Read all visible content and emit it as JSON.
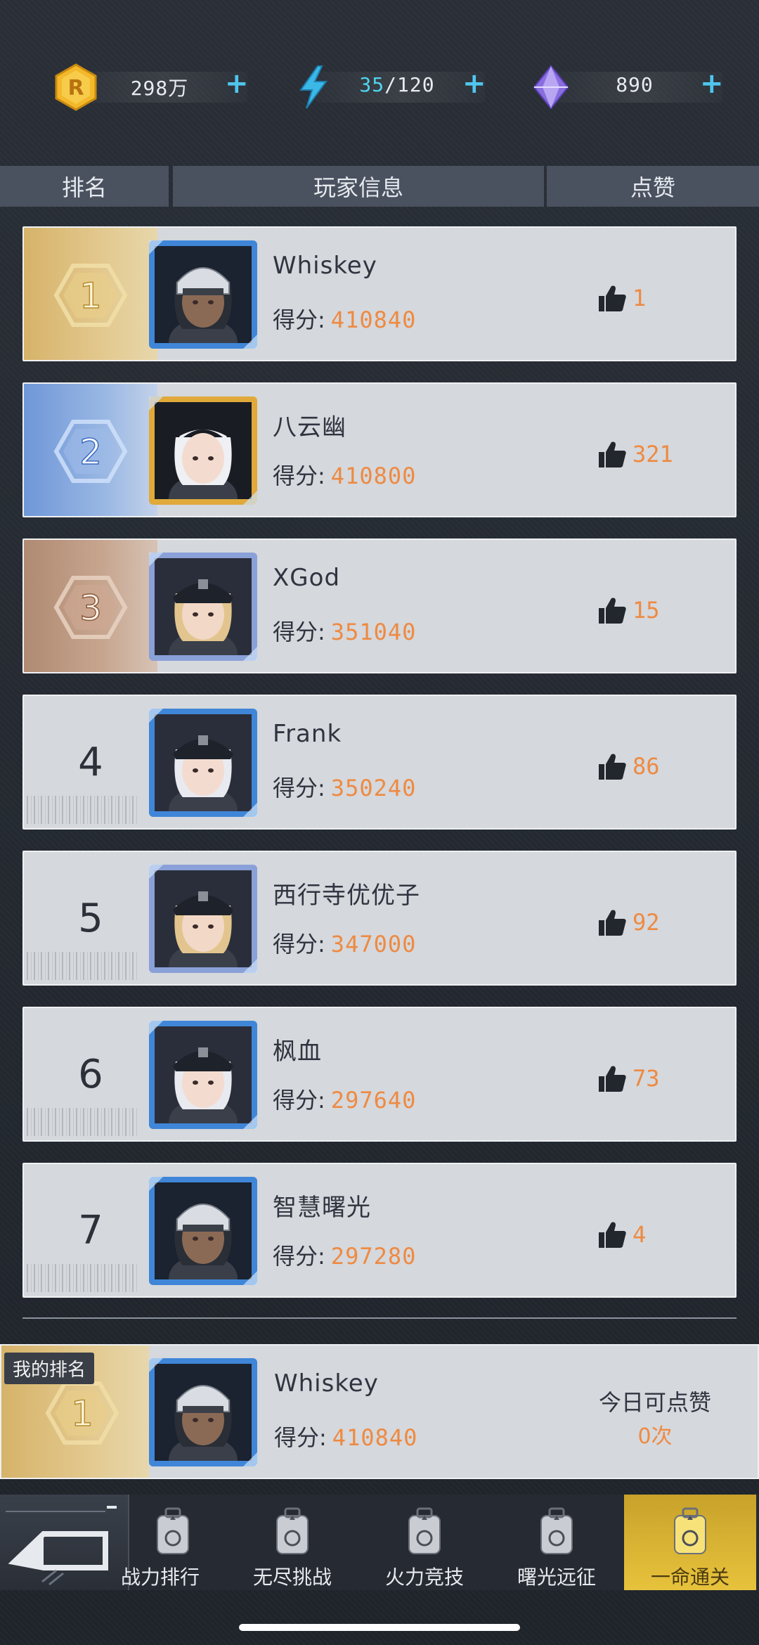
{
  "currency": {
    "coins": "298万",
    "energy_current": "35",
    "energy_max": "/120",
    "gems": "890",
    "plus": "+",
    "coin_icon_letter": "R"
  },
  "header": {
    "rank": "排名",
    "player_info": "玩家信息",
    "likes": "点赞"
  },
  "score_label": "得分:",
  "rows": [
    {
      "rank": "1",
      "name": "Whiskey",
      "score": "410840",
      "likes": "1",
      "avatar": "helmet-male"
    },
    {
      "rank": "2",
      "name": "八云幽",
      "score": "410800",
      "likes": "321",
      "avatar": "white-hair-gold"
    },
    {
      "rank": "3",
      "name": "XGod",
      "score": "351040",
      "likes": "15",
      "avatar": "blonde-cap"
    },
    {
      "rank": "4",
      "name": "Frank",
      "score": "350240",
      "likes": "86",
      "avatar": "white-hair-cap"
    },
    {
      "rank": "5",
      "name": "西行寺优优子",
      "score": "347000",
      "likes": "92",
      "avatar": "blonde-cap"
    },
    {
      "rank": "6",
      "name": "枫血",
      "score": "297640",
      "likes": "73",
      "avatar": "white-hair-cap"
    },
    {
      "rank": "7",
      "name": "智慧曙光",
      "score": "297280",
      "likes": "4",
      "avatar": "helmet-male"
    }
  ],
  "my_rank": {
    "tag": "我的排名",
    "rank": "1",
    "name": "Whiskey",
    "score": "410840",
    "today_label": "今日可点赞",
    "today_value": "0次"
  },
  "nav": {
    "items": [
      {
        "label": "战力排行",
        "shown": "战力排行"
      },
      {
        "label": "无尽挑战"
      },
      {
        "label": "火力竞技"
      },
      {
        "label": "曙光远征"
      },
      {
        "label": "一命通关"
      }
    ],
    "active_index": 4
  },
  "colors": {
    "accent": "#ee8a42",
    "energy": "#4fd4ee",
    "gold": "#d6b36a",
    "silver_blue": "#6f97d8",
    "bronze": "#b08a72"
  }
}
